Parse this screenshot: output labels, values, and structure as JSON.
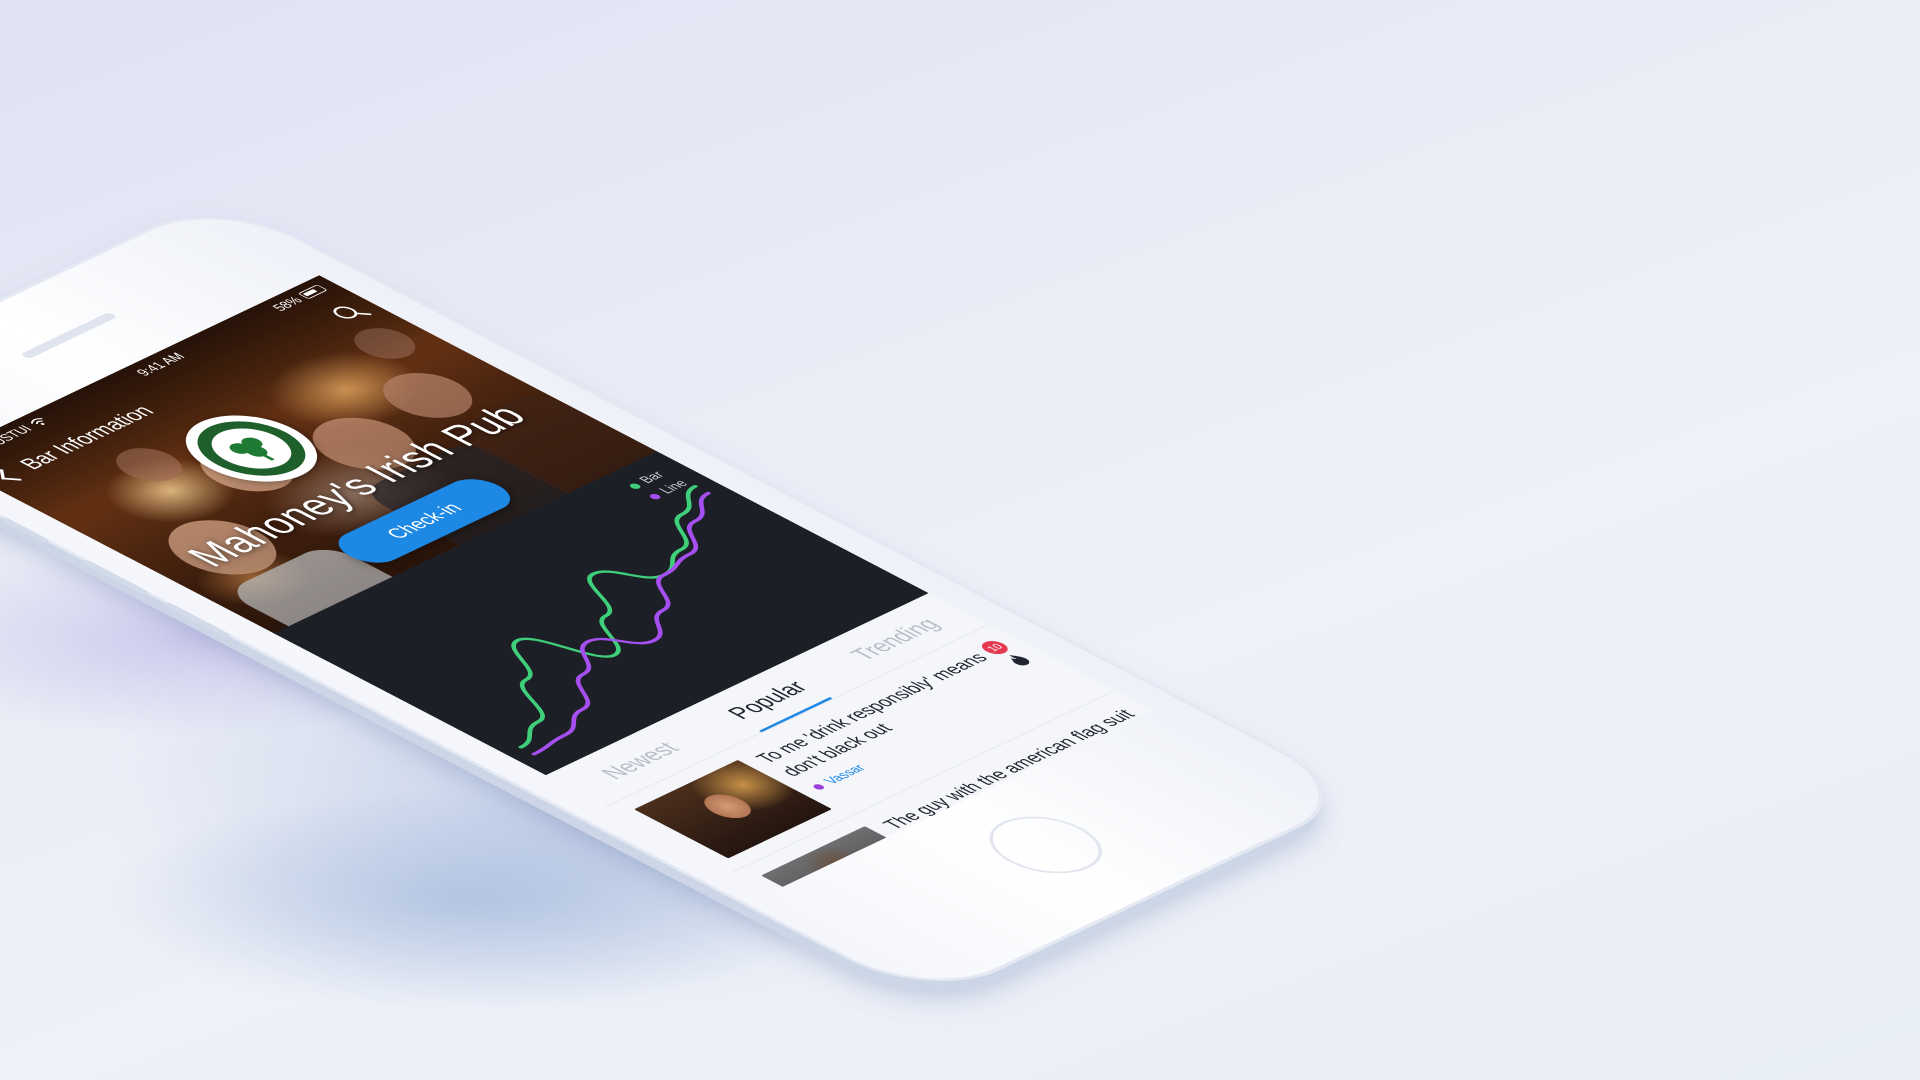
{
  "status_bar": {
    "carrier": "JUSTUI",
    "time": "9:41 AM",
    "battery": "58%"
  },
  "nav": {
    "title": "Bar Information",
    "back_icon": "chevron-left-icon",
    "search_icon": "search-icon"
  },
  "hero": {
    "title": "Mahoney's Irish Pub",
    "checkin_label": "Check-in"
  },
  "chart_data": {
    "type": "line",
    "x": [
      0,
      1,
      2,
      3,
      4,
      5,
      6,
      7,
      8,
      9,
      10
    ],
    "series": [
      {
        "name": "Bar",
        "color": "#3fcf7a",
        "values": [
          10,
          18,
          40,
          60,
          32,
          52,
          74,
          58,
          66,
          82,
          92
        ]
      },
      {
        "name": "Line",
        "color": "#a64ff0",
        "values": [
          4,
          6,
          14,
          30,
          44,
          30,
          42,
          58,
          62,
          76,
          86
        ]
      }
    ],
    "ylim": [
      0,
      100
    ],
    "grid": false,
    "legend": "top-right"
  },
  "tabs": [
    {
      "label": "Newest",
      "active": false
    },
    {
      "label": "Popular",
      "active": true
    },
    {
      "label": "Trending",
      "active": false
    }
  ],
  "feed": [
    {
      "headline": "To me 'drink responsibly' means don't black out",
      "tag": "Vassar",
      "badge": "10"
    },
    {
      "headline": "The guy with the american flag suit is doing life right",
      "tag": "",
      "badge": ""
    }
  ],
  "colors": {
    "accent": "#1e88e5",
    "chart_bg": "#1d1f27",
    "badge": "#e53950",
    "tag_dot": "#9b3fd6"
  }
}
